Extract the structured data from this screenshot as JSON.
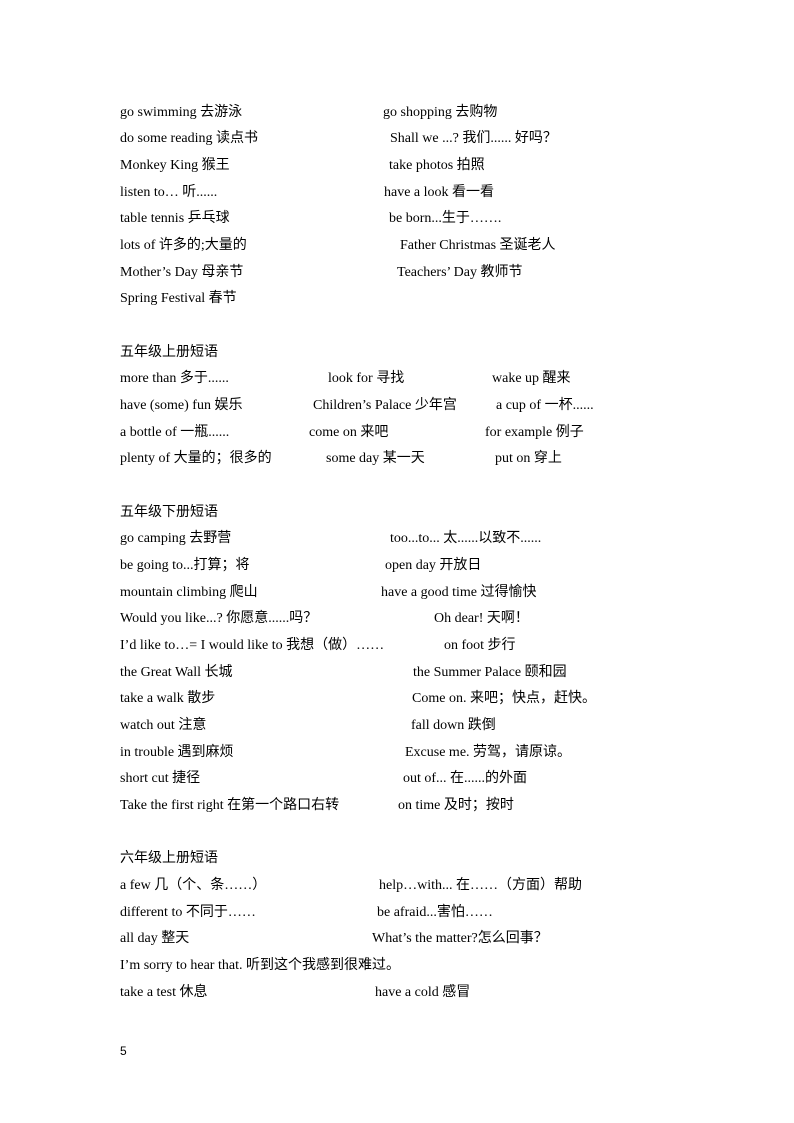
{
  "sections": [
    {
      "heading": "",
      "rows": [
        [
          "go swimming 去游泳",
          "go shopping 去购物"
        ],
        [
          "do some reading 读点书",
          "Shall we ...? 我们...... 好吗？"
        ],
        [
          "Monkey King 猴王",
          "take photos 拍照"
        ],
        [
          "listen to… 听......",
          "have a look  看一看"
        ],
        [
          "table tennis 乒乓球",
          "be born...生于……."
        ],
        [
          "lots of 许多的;大量的",
          "Father Christmas 圣诞老人"
        ],
        [
          "Mother’s Day 母亲节",
          "Teachers’ Day 教师节"
        ],
        [
          "Spring Festival 春节"
        ]
      ]
    },
    {
      "heading": "五年级上册短语",
      "rows": [
        [
          "more than 多于......",
          "look for 寻找",
          "wake up 醒来"
        ],
        [
          "have (some) fun 娱乐",
          "Children’s Palace 少年宫",
          "a cup of 一杯......"
        ],
        [
          "a bottle of 一瓶......",
          "come on 来吧",
          "for example 例子"
        ],
        [
          "plenty of 大量的；很多的",
          "some day 某一天",
          "put on 穿上"
        ]
      ]
    },
    {
      "heading": "五年级下册短语",
      "rows": [
        [
          "go camping 去野营",
          "too...to...  太......以致不......"
        ],
        [
          "be going to...打算；将",
          "open day 开放日"
        ],
        [
          "mountain climbing  爬山",
          "have a good time 过得愉快"
        ],
        [
          "Would you like...? 你愿意......吗？",
          "Oh dear! 天啊！"
        ],
        [
          "I’d like to…= I would like to 我想（做）……",
          "on foot 步行"
        ],
        [
          "the Great Wall 长城",
          "the Summer Palace 颐和园"
        ],
        [
          "take a walk 散步",
          "Come on. 来吧；快点，赶快。"
        ],
        [
          "watch out 注意",
          "fall down 跌倒"
        ],
        [
          "in trouble 遇到麻烦",
          "Excuse me. 劳驾，请原谅。"
        ],
        [
          "short cut 捷径",
          "out of... 在......的外面"
        ],
        [
          "Take the first right 在第一个路口右转",
          "on time 及时；按时"
        ]
      ]
    },
    {
      "heading": "六年级上册短语",
      "rows": [
        [
          "a few 几（个、条……）",
          "help…with... 在……（方面）帮助"
        ],
        [
          "different to 不同于……",
          "be afraid...害怕……"
        ],
        [
          "all day 整天",
          "What’s the matter?怎么回事？"
        ],
        [
          "I’m sorry to hear that. 听到这个我感到很难过。"
        ],
        [
          "take a test 休息",
          "have a cold 感冒"
        ]
      ]
    }
  ],
  "page_number": "5"
}
